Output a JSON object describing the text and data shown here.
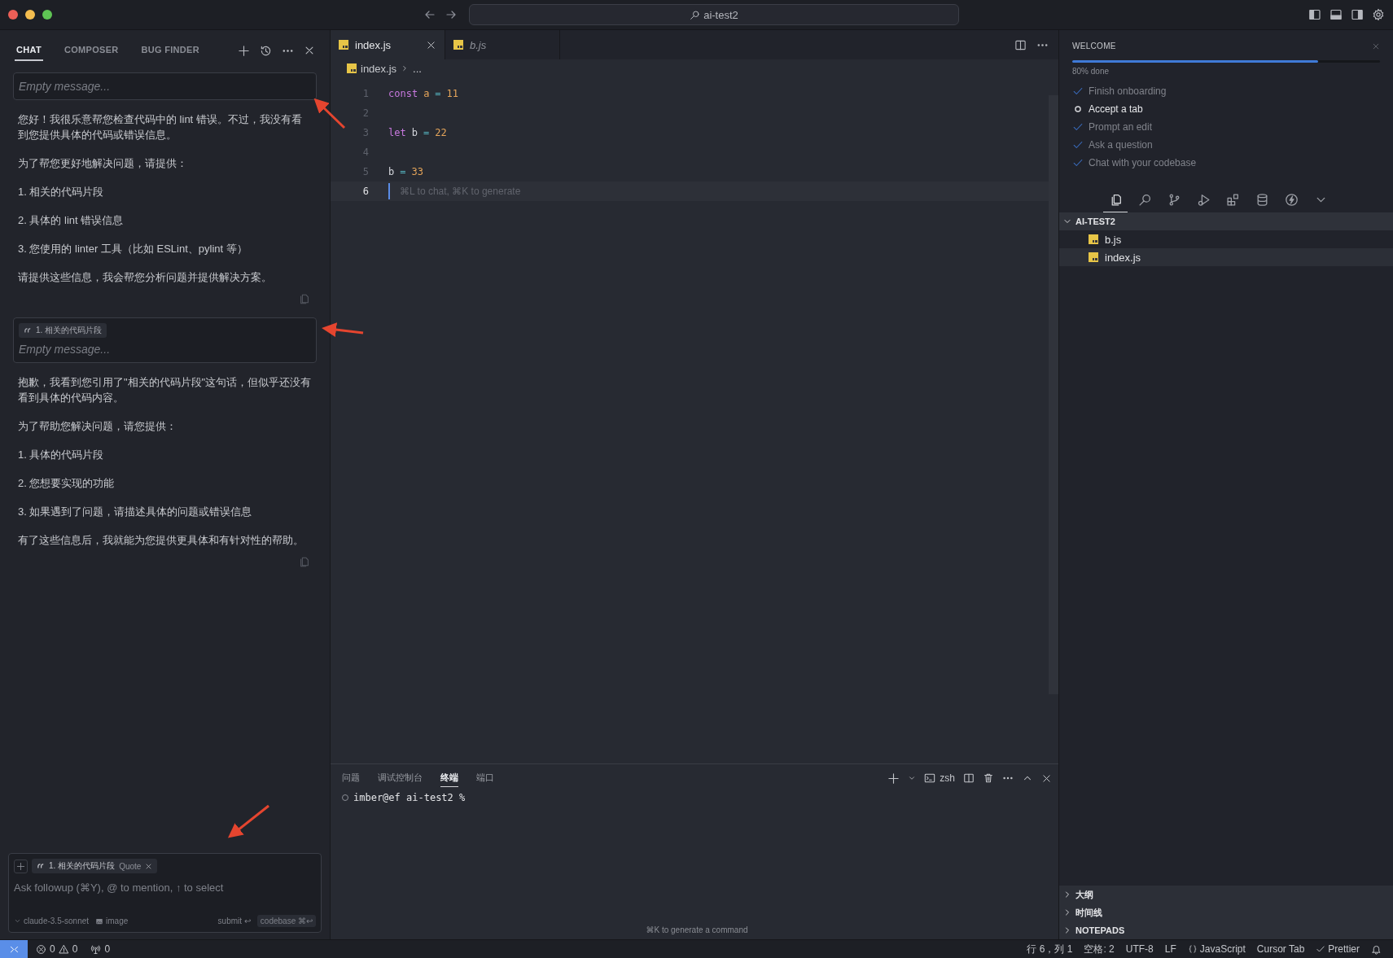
{
  "window": {
    "search": "ai-test2"
  },
  "chat": {
    "tabs": [
      {
        "label": "CHAT",
        "selected": true
      },
      {
        "label": "COMPOSER",
        "selected": false
      },
      {
        "label": "BUG FINDER",
        "selected": false
      }
    ],
    "thread": [
      {
        "kind": "user",
        "placeholder": "Empty message..."
      },
      {
        "kind": "assistant",
        "paragraphs": [
          "您好！我很乐意帮您检查代码中的 lint 错误。不过，我没有看到您提供具体的代码或错误信息。",
          "为了帮您更好地解决问题，请提供：",
          "1. 相关的代码片段",
          "2. 具体的 lint 错误信息",
          "3. 您使用的 linter 工具（比如 ESLint、pylint 等）",
          "请提供这些信息，我会帮您分析问题并提供解决方案。"
        ]
      },
      {
        "kind": "user",
        "quote": "1. 相关的代码片段",
        "placeholder": "Empty message..."
      },
      {
        "kind": "assistant",
        "paragraphs": [
          "抱歉，我看到您引用了\"相关的代码片段\"这句话，但似乎还没有看到具体的代码内容。",
          "为了帮助您解决问题，请您提供：",
          "1. 具体的代码片段",
          "2. 您想要实现的功能",
          "3. 如果遇到了问题，请描述具体的问题或错误信息",
          "有了这些信息后，我就能为您提供更具体和有针对性的帮助。"
        ]
      }
    ],
    "composer": {
      "chip": "1. 相关的代码片段",
      "chip_tag": "Quote",
      "placeholder": "Ask followup (⌘Y), @ to mention, ↑ to select",
      "model": "claude-3.5-sonnet",
      "image": "image",
      "submit": "submit ↩",
      "codebase": "codebase ⌘↩"
    }
  },
  "editor": {
    "tabs": [
      {
        "label": "index.js",
        "selected": true,
        "preview": false
      },
      {
        "label": "b.js",
        "selected": false,
        "preview": true
      }
    ],
    "breadcrumb": [
      "index.js",
      "..."
    ],
    "lines": [
      {
        "number": "1",
        "current": false,
        "tokens": [
          {
            "text": "const",
            "kind": "keyword"
          },
          {
            "text": "a",
            "kind": "constant"
          },
          {
            "text": "=",
            "kind": "operator"
          },
          {
            "text": "11",
            "kind": "number"
          }
        ]
      },
      {
        "number": "2",
        "current": false
      },
      {
        "number": "3",
        "current": false,
        "tokens": [
          {
            "text": "let",
            "kind": "keyword"
          },
          {
            "text": "b",
            "kind": "plain"
          },
          {
            "text": "=",
            "kind": "operator"
          },
          {
            "text": "22",
            "kind": "number"
          }
        ]
      },
      {
        "number": "4",
        "current": false
      },
      {
        "number": "5",
        "current": false,
        "tokens": [
          {
            "text": "b",
            "kind": "plain"
          },
          {
            "text": "=",
            "kind": "operator"
          },
          {
            "text": "33",
            "kind": "number"
          }
        ]
      },
      {
        "number": "6",
        "current": true,
        "hint": "⌘L to chat, ⌘K to generate"
      }
    ],
    "panel": {
      "tabs": [
        {
          "label": "问题",
          "selected": false
        },
        {
          "label": "调试控制台",
          "selected": false
        },
        {
          "label": "终端",
          "selected": true
        },
        {
          "label": "端口",
          "selected": false
        }
      ],
      "shell": "zsh",
      "prompt": "imber@ef ai-test2 %",
      "hint": "⌘K to generate a command"
    }
  },
  "welcome": {
    "title": "WELCOME",
    "level": 0.8,
    "progress": "80% done",
    "tasks": [
      {
        "label": "Finish onboarding",
        "done": true
      },
      {
        "label": "Accept a tab",
        "done": false
      },
      {
        "label": "Prompt an edit",
        "done": true
      },
      {
        "label": "Ask a question",
        "done": true
      },
      {
        "label": "Chat with your codebase",
        "done": true
      }
    ]
  },
  "activity": [
    {
      "kind": "files",
      "selected": true
    },
    {
      "kind": "search",
      "selected": false
    },
    {
      "kind": "branch",
      "selected": false
    },
    {
      "kind": "run",
      "selected": false
    },
    {
      "kind": "extensions",
      "selected": false
    },
    {
      "kind": "database",
      "selected": false
    },
    {
      "kind": "bolt",
      "selected": false
    },
    {
      "kind": "more",
      "selected": false
    }
  ],
  "explorer": {
    "title": "AI-TEST2",
    "expanded": true,
    "files": [
      {
        "name": "b.js",
        "selected": false
      },
      {
        "name": "index.js",
        "selected": true
      }
    ]
  },
  "sections": [
    {
      "label": "大纲",
      "expanded": false
    },
    {
      "label": "时间线",
      "expanded": false
    },
    {
      "label": "NOTEPADS",
      "expanded": false
    }
  ],
  "status_bar": {
    "errors": "0",
    "warnings": "0",
    "ports": "0",
    "items": [
      {
        "text": "行 6，列 1",
        "kind": "text"
      },
      {
        "text": "空格: 2",
        "kind": "text"
      },
      {
        "text": "UTF-8",
        "kind": "text"
      },
      {
        "text": "LF",
        "kind": "text"
      },
      {
        "text": "JavaScript",
        "kind": "language"
      },
      {
        "text": "Cursor Tab",
        "kind": "text"
      },
      {
        "text": "Prettier",
        "kind": "formatter"
      }
    ]
  }
}
